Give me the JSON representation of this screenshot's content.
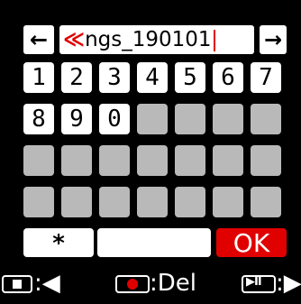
{
  "top_row": {
    "left_arrow": "←",
    "right_arrow": "→",
    "name_field": {
      "overflow_mark": "≪",
      "value": "ngs_190101"
    }
  },
  "keys": {
    "row1": [
      "1",
      "2",
      "3",
      "4",
      "5",
      "6",
      "7"
    ],
    "row2": [
      "8",
      "9",
      "0"
    ]
  },
  "actions": {
    "symbol_label": "*",
    "space_label": "",
    "ok_label": "OK"
  },
  "legend": {
    "stop_text": ":◀",
    "rec_text": ":Del",
    "play_text": ":▶"
  },
  "colors": {
    "accent_red": "#e00000",
    "key_white": "#ffffff",
    "key_empty": "#b9b9b9",
    "background": "#000000"
  }
}
